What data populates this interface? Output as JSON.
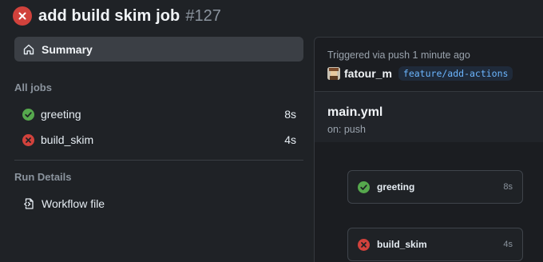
{
  "header": {
    "title": "add build skim job",
    "run_number": "#127",
    "status": "failure"
  },
  "sidebar": {
    "summary_label": "Summary",
    "all_jobs_heading": "All jobs",
    "jobs": [
      {
        "name": "greeting",
        "duration": "8s",
        "status": "success"
      },
      {
        "name": "build_skim",
        "duration": "4s",
        "status": "failure"
      }
    ],
    "run_details_heading": "Run Details",
    "workflow_file_label": "Workflow file"
  },
  "main": {
    "trigger_text": "Triggered via push 1 minute ago",
    "actor": "fatour_m",
    "branch": "feature/add-actions",
    "workflow_name": "main.yml",
    "workflow_trigger": "on: push",
    "graph_jobs": [
      {
        "name": "greeting",
        "duration": "8s",
        "status": "success"
      },
      {
        "name": "build_skim",
        "duration": "4s",
        "status": "failure"
      }
    ]
  },
  "colors": {
    "success": "#56a84d",
    "failure": "#d1423c",
    "branch_text": "#6cb6ff"
  },
  "icons": [
    "x-circle-icon",
    "home-icon",
    "check-circle-icon",
    "workflow-file-icon",
    "avatar"
  ]
}
